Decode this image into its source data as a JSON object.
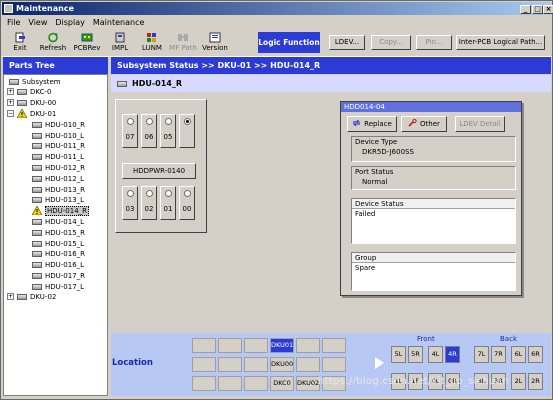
{
  "window": {
    "title": "Maintenance"
  },
  "menu": [
    "File",
    "View",
    "Display",
    "Maintenance"
  ],
  "toolbar": {
    "exit": "Exit",
    "refresh": "Refresh",
    "pcbrev": "PCBRev",
    "impl": "IMPL",
    "lunm": "LUNM",
    "mfpath": "MF Path",
    "version": "Version",
    "logic_function": "Logic Function",
    "ldev": "LDEV...",
    "copy": "Copy...",
    "pin": "Pin...",
    "interpcb": "Inter-PCB Logical Path..."
  },
  "parts_tree": {
    "title": "Parts Tree",
    "items": [
      {
        "label": "Subsystem"
      },
      {
        "label": "DKC-0"
      },
      {
        "label": "DKU-00"
      },
      {
        "label": "DKU-01"
      },
      {
        "label": "HDU-010_R"
      },
      {
        "label": "HDU-010_L"
      },
      {
        "label": "HDU-011_R"
      },
      {
        "label": "HDU-011_L"
      },
      {
        "label": "HDU-012_R"
      },
      {
        "label": "HDU-012_L"
      },
      {
        "label": "HDU-013_R"
      },
      {
        "label": "HDU-013_L"
      },
      {
        "label": "HDU-014_R"
      },
      {
        "label": "HDU-014_L"
      },
      {
        "label": "HDU-015_R"
      },
      {
        "label": "HDU-015_L"
      },
      {
        "label": "HDU-016_R"
      },
      {
        "label": "HDU-016_L"
      },
      {
        "label": "HDU-017_R"
      },
      {
        "label": "HDU-017_L"
      },
      {
        "label": "DKU-02"
      }
    ]
  },
  "breadcrumb": "Subsystem Status  >> DKU-01  >> HDU-014_R",
  "subheader": "HDU-014_R",
  "chassis": {
    "top_slots": [
      "07",
      "06",
      "05",
      ""
    ],
    "power": "HDDPWR-0140",
    "bottom_slots": [
      "03",
      "02",
      "01",
      "00"
    ]
  },
  "popup": {
    "title": "HDD014-04",
    "replace": "Replace",
    "other": "Other",
    "ldev_detail": "LDEV Detail",
    "device_type_label": "Device Type",
    "device_type_value": "DKR5D-J600SS",
    "port_status_label": "Port Status",
    "port_status_value": "Normal",
    "device_status_label": "Device Status",
    "device_status_value": "Failed",
    "group_label": "Group",
    "group_value": "Spare"
  },
  "location": {
    "label": "Location",
    "dku01": "DKU01",
    "dku00": "DKU00",
    "dkc0": "DKC0",
    "dku02": "DKU02",
    "front_label": "Front",
    "back_label": "Back",
    "front_row1": [
      "5L",
      "5R",
      "4L",
      "4R"
    ],
    "back_row1": [
      "7L",
      "7R",
      "6L",
      "6R"
    ],
    "front_row2": [
      "1L",
      "1R",
      "0L",
      "0R"
    ],
    "back_row2": [
      "3L",
      "3R",
      "2L",
      "2R"
    ]
  },
  "watermark": "https://blog.csdn.net/kit_jio_sichuan",
  "colors": {
    "accent": "#2b3bd4",
    "location_bg": "#b8c8f4",
    "popup_title": "#6070e0"
  }
}
